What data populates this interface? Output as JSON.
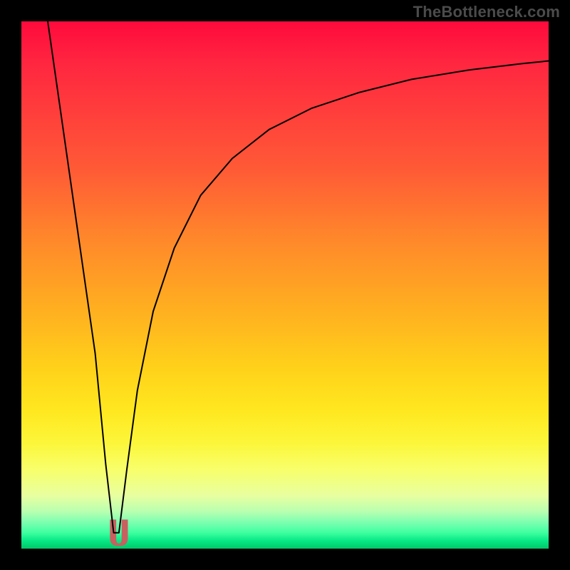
{
  "chart_data": {
    "type": "line",
    "title": "",
    "xlabel": "",
    "ylabel": "",
    "xlim": [
      0,
      100
    ],
    "ylim": [
      0,
      100
    ],
    "grid": false,
    "legend": false,
    "notes": "Heat gradient runs top (red ≈ 100) down to bottom (green ≈ 0). Black curve traces a sharp V dipping to the green band near x≈18 then climbing asymptotically toward the top-right. A short pale-red block marks the bottom of the V.",
    "series": [
      {
        "name": "bottleneck-curve",
        "x": [
          5,
          8,
          11,
          14,
          16,
          17.5,
          18.5,
          20,
          22,
          25,
          29,
          34,
          40,
          47,
          55,
          64,
          74,
          85,
          95,
          100
        ],
        "values": [
          100,
          79,
          58,
          37,
          16,
          3,
          3,
          15,
          30,
          45,
          57,
          67,
          74,
          79.5,
          83.5,
          86.5,
          89,
          90.8,
          92,
          92.5
        ]
      }
    ],
    "marker": {
      "name": "v-bottom-marker",
      "x_range": [
        16.8,
        20.2
      ],
      "y_range": [
        0.5,
        5.5
      ],
      "color": "#c86060"
    },
    "background_gradient": {
      "stops": [
        {
          "pos": 0.0,
          "color": "#ff0a3c"
        },
        {
          "pos": 0.28,
          "color": "#ff5a36"
        },
        {
          "pos": 0.55,
          "color": "#ffb020"
        },
        {
          "pos": 0.8,
          "color": "#fcf63a"
        },
        {
          "pos": 0.95,
          "color": "#7cffb0"
        },
        {
          "pos": 1.0,
          "color": "#00c868"
        }
      ]
    }
  },
  "credit": "TheBottleneck.com"
}
